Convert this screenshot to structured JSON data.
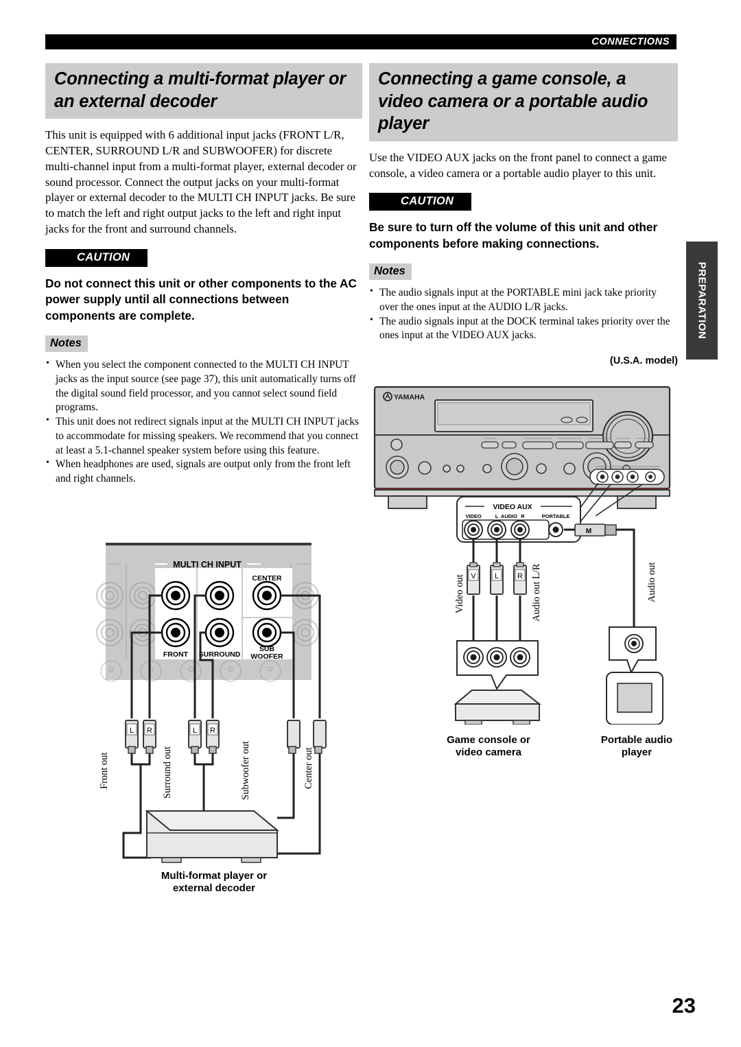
{
  "page": {
    "chapter": "CONNECTIONS",
    "side_tab": "PREPARATION",
    "number": "23"
  },
  "left_column": {
    "title": "Connecting a multi-format player or an external decoder",
    "body": "This unit is equipped with 6 additional input jacks (FRONT L/R, CENTER, SURROUND L/R and SUBWOOFER) for discrete multi-channel input from a multi-format player, external decoder or sound processor. Connect the output jacks on your multi-format player or external decoder to the MULTI CH INPUT jacks. Be sure to match the left and right output jacks to the left and right input jacks for the front and surround channels.",
    "caution_label": "CAUTION",
    "caution_text": "Do not connect this unit or other components to the AC power supply until all connections between components are complete.",
    "notes_label": "Notes",
    "notes": [
      "When you select the component connected to the MULTI CH INPUT jacks as the input source (see page 37), this unit automatically turns off the digital sound field processor, and you cannot select sound field programs.",
      "This unit does not redirect signals input at the MULTI CH INPUT jacks to accommodate for missing speakers. We recommend that you connect at least a 5.1-channel speaker system before using this feature.",
      "When headphones are used, signals are output only from the front left and right channels."
    ],
    "figure": {
      "panel_label": "MULTI CH INPUT",
      "jack_labels": {
        "front": "FRONT",
        "surround": "SURROUND",
        "center": "CENTER",
        "subwoofer_line1": "SUB",
        "subwoofer_line2": "WOOFER"
      },
      "plug_labels": {
        "left": "L",
        "right": "R"
      },
      "cable_labels": {
        "front": "Front out",
        "surround": "Surround out",
        "subwoofer": "Subwoofer out",
        "center": "Center out"
      },
      "device_caption_line1": "Multi-format player or",
      "device_caption_line2": "external decoder"
    }
  },
  "right_column": {
    "title": "Connecting a game console, a video camera or a portable audio player",
    "body": "Use the VIDEO AUX jacks on the front panel to connect a game console, a video camera or a portable audio player to this unit.",
    "caution_label": "CAUTION",
    "caution_text": "Be sure to turn off the volume of this unit and other components before making connections.",
    "notes_label": "Notes",
    "notes": [
      "The audio signals input at the PORTABLE mini jack take priority over the ones input at the AUDIO L/R jacks.",
      "The audio signals input at the DOCK terminal takes priority over the ones input at the VIDEO AUX jacks."
    ],
    "model_note": "(U.S.A. model)",
    "figure": {
      "brand": "YAMAHA",
      "panel_label": "VIDEO AUX",
      "jack_labels": {
        "video": "VIDEO",
        "audio_left": "L",
        "audio": "AUDIO",
        "audio_right": "R",
        "portable": "PORTABLE"
      },
      "plug_labels": {
        "video": "V",
        "left": "L",
        "right": "R",
        "mini": "M"
      },
      "cable_labels": {
        "video_out": "Video out",
        "audio_out_lr": "Audio out L/R",
        "audio_out": "Audio out"
      },
      "device_caption_1_line1": "Game console or",
      "device_caption_1_line2": "video camera",
      "device_caption_2_line1": "Portable audio",
      "device_caption_2_line2": "player"
    }
  }
}
